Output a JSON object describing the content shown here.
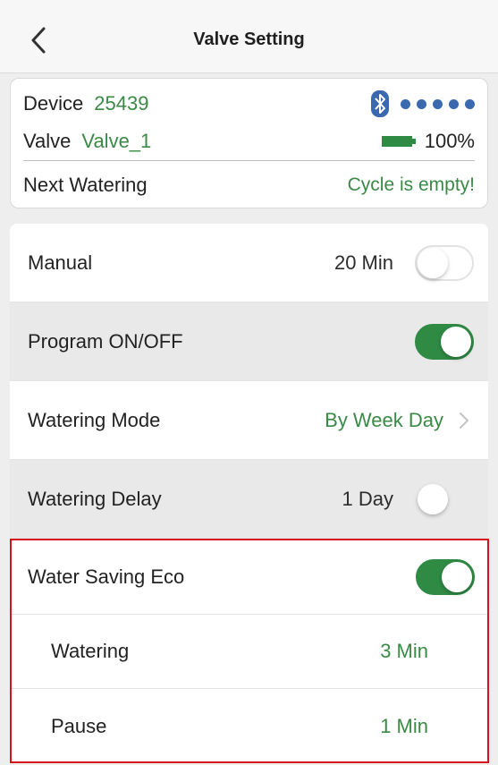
{
  "header": {
    "title": "Valve Setting"
  },
  "device_card": {
    "device_label": "Device",
    "device_id": "25439",
    "valve_label": "Valve",
    "valve_name": "Valve_1",
    "battery_percent": "100%",
    "next_watering_label": "Next Watering",
    "next_watering_value": "Cycle is empty!"
  },
  "settings": {
    "manual": {
      "label": "Manual",
      "value": "20 Min",
      "enabled": false
    },
    "program": {
      "label": "Program ON/OFF",
      "enabled": true
    },
    "watering_mode": {
      "label": "Watering Mode",
      "value": "By Week Day"
    },
    "watering_delay": {
      "label": "Watering Delay",
      "value": "1 Day",
      "enabled": false
    }
  },
  "eco": {
    "label": "Water Saving Eco",
    "enabled": true,
    "watering": {
      "label": "Watering",
      "value": "3 Min"
    },
    "pause": {
      "label": "Pause",
      "value": "1 Min"
    }
  },
  "colors": {
    "accent_green": "#3a8a46",
    "toggle_green": "#2f8a44",
    "bluetooth_blue": "#3b69b0",
    "highlight_red": "#d7121f"
  },
  "icons": [
    "back-icon",
    "bluetooth-icon",
    "signal-dots-icon",
    "battery-icon",
    "chevron-right-icon"
  ]
}
